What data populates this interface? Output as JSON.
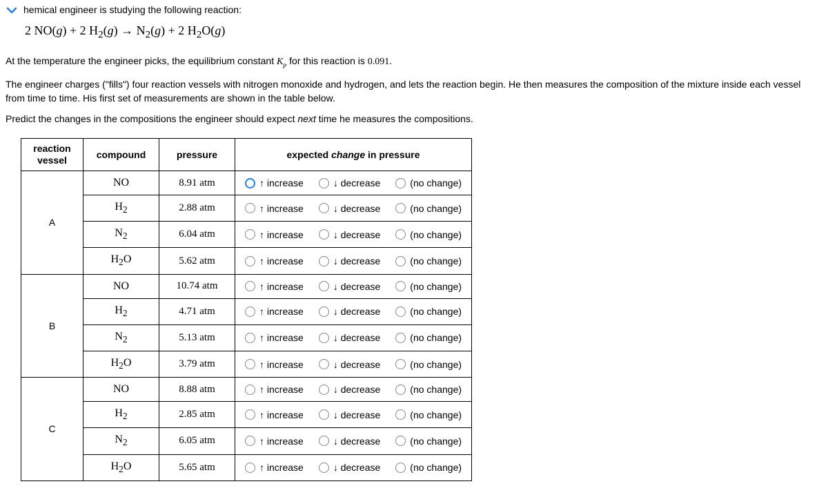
{
  "intro": "hemical engineer is studying the following reaction:",
  "equation_html": "2 NO(<i>g</i>) + 2 H<sub>2</sub>(<i>g</i>) → N<sub>2</sub>(<i>g</i>) + 2 H<sub>2</sub>O(<i>g</i>)",
  "kp_line_pre": "At the temperature the engineer picks, the equilibrium constant ",
  "kp_line_post": " for this reaction is ",
  "kp_value": "0.091",
  "para2": "The engineer charges (\"fills\") four reaction vessels with nitrogen monoxide and hydrogen, and lets the reaction begin. He then measures the composition of the mixture inside each vessel from time to time. His first set of measurements are shown in the table below.",
  "para3_pre": "Predict the changes in the compositions the engineer should expect ",
  "para3_emph": "next",
  "para3_post": " time he measures the compositions.",
  "headers": {
    "vessel": "reaction vessel",
    "compound": "compound",
    "pressure": "pressure",
    "expected_pre": "expected ",
    "expected_emph": "change",
    "expected_post": " in pressure"
  },
  "choice_labels": {
    "increase": "↑ increase",
    "decrease": "↓ decrease",
    "nochange": "(no change)"
  },
  "vessels": [
    {
      "name": "A",
      "rows": [
        {
          "compound_html": "NO",
          "pressure": "8.91 atm",
          "highlight": true
        },
        {
          "compound_html": "H<sub>2</sub>",
          "pressure": "2.88 atm",
          "highlight": false
        },
        {
          "compound_html": "N<sub>2</sub>",
          "pressure": "6.04 atm",
          "highlight": false
        },
        {
          "compound_html": "H<sub>2</sub>O",
          "pressure": "5.62 atm",
          "highlight": false
        }
      ]
    },
    {
      "name": "B",
      "rows": [
        {
          "compound_html": "NO",
          "pressure": "10.74 atm",
          "highlight": false
        },
        {
          "compound_html": "H<sub>2</sub>",
          "pressure": "4.71 atm",
          "highlight": false
        },
        {
          "compound_html": "N<sub>2</sub>",
          "pressure": "5.13 atm",
          "highlight": false
        },
        {
          "compound_html": "H<sub>2</sub>O",
          "pressure": "3.79 atm",
          "highlight": false
        }
      ]
    },
    {
      "name": "C",
      "rows": [
        {
          "compound_html": "NO",
          "pressure": "8.88 atm",
          "highlight": false
        },
        {
          "compound_html": "H<sub>2</sub>",
          "pressure": "2.85 atm",
          "highlight": false
        },
        {
          "compound_html": "N<sub>2</sub>",
          "pressure": "6.05 atm",
          "highlight": false
        },
        {
          "compound_html": "H<sub>2</sub>O",
          "pressure": "5.65 atm",
          "highlight": false
        }
      ]
    }
  ]
}
